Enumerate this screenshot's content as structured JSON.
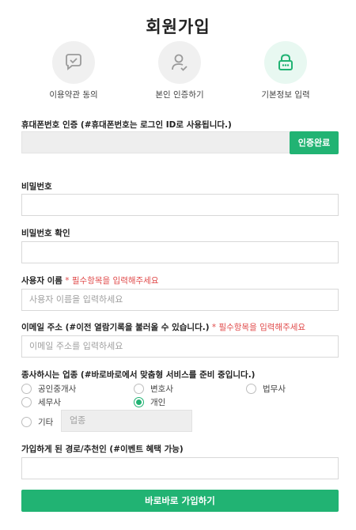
{
  "page": {
    "title": "회원가입"
  },
  "steps": [
    {
      "label": "이용약관 동의",
      "icon": "chat-check-icon"
    },
    {
      "label": "본인 인증하기",
      "icon": "user-check-icon"
    },
    {
      "label": "기본정보 입력",
      "icon": "lock-icon"
    }
  ],
  "accent_color": "#21b373",
  "required_color": "#e04b4b",
  "phone": {
    "label": "휴대폰번호 인증 (#휴대폰번호는 로그인 ID로 사용됩니다.)",
    "value": "",
    "verify_label": "인증완료"
  },
  "password": {
    "label": "비밀번호",
    "value": ""
  },
  "password_confirm": {
    "label": "비밀번호 확인",
    "value": ""
  },
  "username": {
    "label": "사용자 이름",
    "required_note": " * 필수항목을 입력해주세요",
    "placeholder": "사용자 이름을 입력하세요"
  },
  "email": {
    "label": "이메일 주소 (#이전 열람기록을 불러올 수 있습니다.)",
    "required_note": " * 필수항목을 입력해주세요",
    "placeholder": "이메일 주소를 입력하세요"
  },
  "occupation": {
    "label": "종사하시는 업종 (#바로바로에서 맞춤형 서비스를 준비 중입니다.)",
    "options": [
      "공인중개사",
      "변호사",
      "법무사",
      "세무사",
      "개인",
      "기타"
    ],
    "selected": "개인",
    "etc_placeholder": "업종"
  },
  "referral": {
    "label": "가입하게 된 경로/추천인 (#이벤트 혜택 가능)",
    "value": ""
  },
  "submit_label": "바로바로 가입하기"
}
